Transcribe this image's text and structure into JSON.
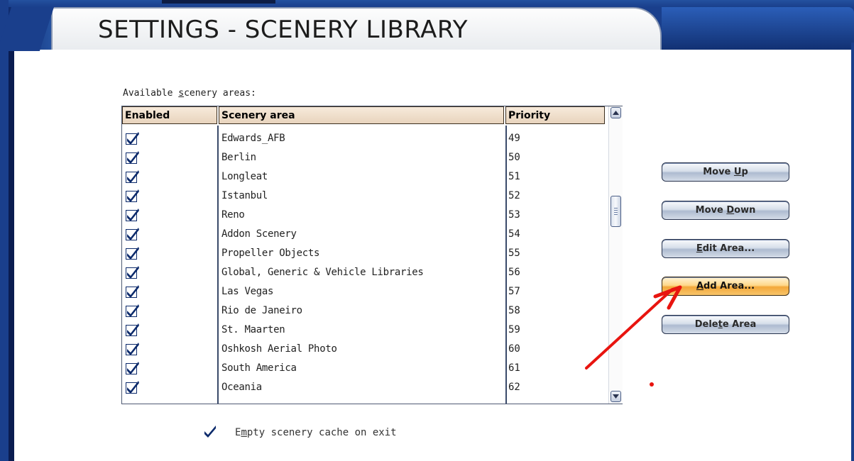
{
  "window": {
    "title": "SETTINGS - SCENERY LIBRARY"
  },
  "list": {
    "label_pre": "Available ",
    "label_accel": "s",
    "label_post": "cenery areas:",
    "headers": {
      "enabled": "Enabled",
      "area": "Scenery area",
      "priority": "Priority"
    },
    "rows": [
      {
        "enabled": true,
        "area": "Edwards_AFB",
        "priority": "49"
      },
      {
        "enabled": true,
        "area": "Berlin",
        "priority": "50"
      },
      {
        "enabled": true,
        "area": "Longleat",
        "priority": "51"
      },
      {
        "enabled": true,
        "area": "Istanbul",
        "priority": "52"
      },
      {
        "enabled": true,
        "area": "Reno",
        "priority": "53"
      },
      {
        "enabled": true,
        "area": "Addon Scenery",
        "priority": "54"
      },
      {
        "enabled": true,
        "area": "Propeller Objects",
        "priority": "55"
      },
      {
        "enabled": true,
        "area": "Global, Generic & Vehicle Libraries",
        "priority": "56"
      },
      {
        "enabled": true,
        "area": "Las Vegas",
        "priority": "57"
      },
      {
        "enabled": true,
        "area": "Rio de Janeiro",
        "priority": "58"
      },
      {
        "enabled": true,
        "area": "St. Maarten",
        "priority": "59"
      },
      {
        "enabled": true,
        "area": "Oshkosh Aerial Photo",
        "priority": "60"
      },
      {
        "enabled": true,
        "area": "South America",
        "priority": "61"
      },
      {
        "enabled": true,
        "area": "Oceania",
        "priority": "62"
      }
    ]
  },
  "buttons": {
    "move_up": {
      "pre": "Move ",
      "accel": "U",
      "post": "p"
    },
    "move_down": {
      "pre": "Move ",
      "accel": "D",
      "post": "own"
    },
    "edit_area": {
      "pre": "",
      "accel": "E",
      "post": "dit Area..."
    },
    "add_area": {
      "pre": "",
      "accel": "A",
      "post": "dd Area..."
    },
    "delete_area": {
      "pre": "Dele",
      "accel": "t",
      "post": "e Area"
    }
  },
  "cache_option": {
    "checked": true,
    "label_pre": "E",
    "label_accel": "m",
    "label_post": "pty scenery cache on exit"
  },
  "colors": {
    "frame_blue": "#1a3f8c",
    "highlight_orange": "#f3a83a",
    "annotation_red": "#e8140f"
  }
}
